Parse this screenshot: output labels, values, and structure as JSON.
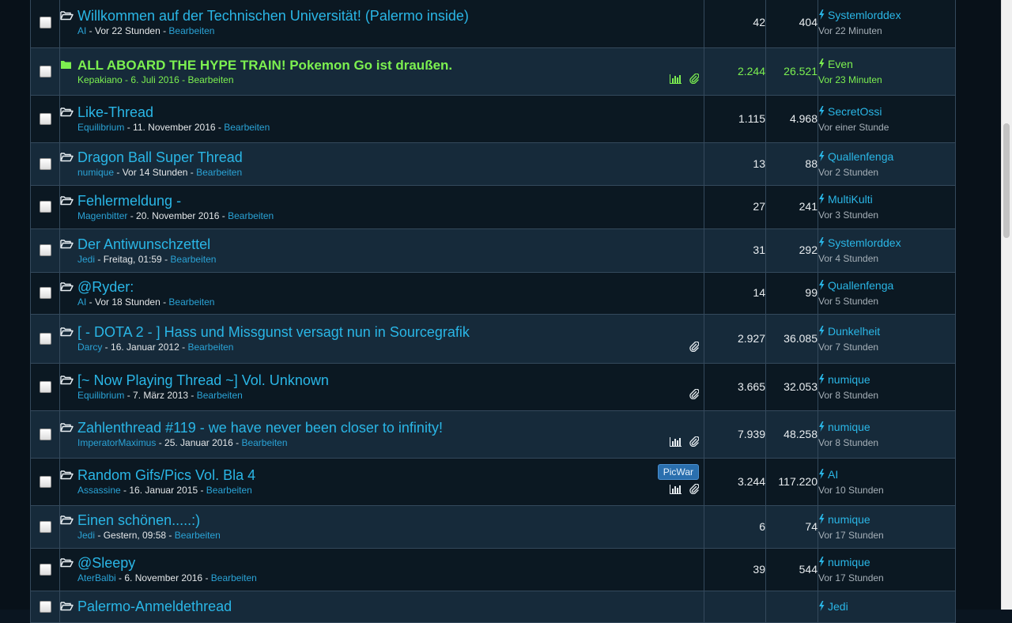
{
  "colors": {
    "link": "#2ab6e6",
    "sticky": "#7cf050",
    "row_dark": "#0b1822",
    "row_light": "#162a3a",
    "badge": "#2a6fae"
  },
  "threads": [
    {
      "title": "Willkommen auf der Technischen Universität! (Palermo inside)",
      "author": "AI",
      "date": "Vor 22 Stunden",
      "edit": "Bearbeiten",
      "replies": "42",
      "views": "404",
      "last_user": "Systemlorddex",
      "last_time": "Vor 22 Minuten",
      "row": "odd"
    },
    {
      "title": "ALL ABOARD THE HYPE TRAIN! Pokemon Go ist draußen.",
      "author": "Kepakiano",
      "date": "6. Juli 2016",
      "edit": "Bearbeiten",
      "replies": "2.244",
      "views": "26.521",
      "last_user": "Even",
      "last_time": "Vor 23 Minuten",
      "row": "even",
      "sticky": true,
      "icons": [
        "poll-icon",
        "attachment-icon"
      ]
    },
    {
      "title": "Like-Thread",
      "author": "Equilibrium",
      "date": "11. November 2016",
      "edit": "Bearbeiten",
      "replies": "1.115",
      "views": "4.968",
      "last_user": "SecretOssi",
      "last_time": "Vor einer Stunde",
      "row": "odd"
    },
    {
      "title": "Dragon Ball Super Thread",
      "author": "numique",
      "date": "Vor 14 Stunden",
      "edit": "Bearbeiten",
      "replies": "13",
      "views": "88",
      "last_user": "Quallenfenga",
      "last_time": "Vor 2 Stunden",
      "row": "even"
    },
    {
      "title": "Fehlermeldung -",
      "author": "Magenbitter",
      "date": "20. November 2016",
      "edit": "Bearbeiten",
      "replies": "27",
      "views": "241",
      "last_user": "MultiKulti",
      "last_time": "Vor 3 Stunden",
      "row": "odd"
    },
    {
      "title": "Der Antiwunschzettel",
      "author": "Jedi",
      "date": "Freitag, 01:59",
      "edit": "Bearbeiten",
      "replies": "31",
      "views": "292",
      "last_user": "Systemlorddex",
      "last_time": "Vor 4 Stunden",
      "row": "even"
    },
    {
      "title": "@Ryder:",
      "author": "AI",
      "date": "Vor 18 Stunden",
      "edit": "Bearbeiten",
      "replies": "14",
      "views": "99",
      "last_user": "Quallenfenga",
      "last_time": "Vor 5 Stunden",
      "row": "odd"
    },
    {
      "title": "[ - DOTA 2 - ] Hass und Missgunst versagt nun in Sourcegrafik",
      "author": "Darcy",
      "date": "16. Januar 2012",
      "edit": "Bearbeiten",
      "replies": "2.927",
      "views": "36.085",
      "last_user": "Dunkelheit",
      "last_time": "Vor 7 Stunden",
      "row": "even",
      "icons": [
        "attachment-icon"
      ]
    },
    {
      "title": "[~ Now Playing Thread ~] Vol. Unknown",
      "author": "Equilibrium",
      "date": "7. März 2013",
      "edit": "Bearbeiten",
      "replies": "3.665",
      "views": "32.053",
      "last_user": "numique",
      "last_time": "Vor 8 Stunden",
      "row": "odd",
      "icons": [
        "attachment-icon"
      ]
    },
    {
      "title": "Zahlenthread #119 - we have never been closer to infinity!",
      "author": "ImperatorMaximus",
      "date": "25. Januar 2016",
      "edit": "Bearbeiten",
      "replies": "7.939",
      "views": "48.258",
      "last_user": "numique",
      "last_time": "Vor 8 Stunden",
      "row": "even",
      "icons": [
        "poll-icon",
        "attachment-icon"
      ]
    },
    {
      "title": "Random Gifs/Pics Vol. Bla 4",
      "author": "Assassine",
      "date": "16. Januar 2015",
      "edit": "Bearbeiten",
      "replies": "3.244",
      "views": "117.220",
      "last_user": "AI",
      "last_time": "Vor 10 Stunden",
      "row": "odd",
      "badge": "PicWar",
      "icons": [
        "poll-icon",
        "attachment-icon"
      ]
    },
    {
      "title": "Einen schönen.....:)",
      "author": "Jedi",
      "date": "Gestern, 09:58",
      "edit": "Bearbeiten",
      "replies": "6",
      "views": "74",
      "last_user": "numique",
      "last_time": "Vor 17 Stunden",
      "row": "even"
    },
    {
      "title": "@Sleepy",
      "author": "AterBalbi",
      "date": "6. November 2016",
      "edit": "Bearbeiten",
      "replies": "39",
      "views": "544",
      "last_user": "numique",
      "last_time": "Vor 17 Stunden",
      "row": "odd"
    },
    {
      "title": "Palermo-Anmeldethread",
      "author": "",
      "date": "",
      "edit": "",
      "replies": "",
      "views": "",
      "last_user": "Jedi",
      "last_time": "",
      "row": "even"
    }
  ]
}
